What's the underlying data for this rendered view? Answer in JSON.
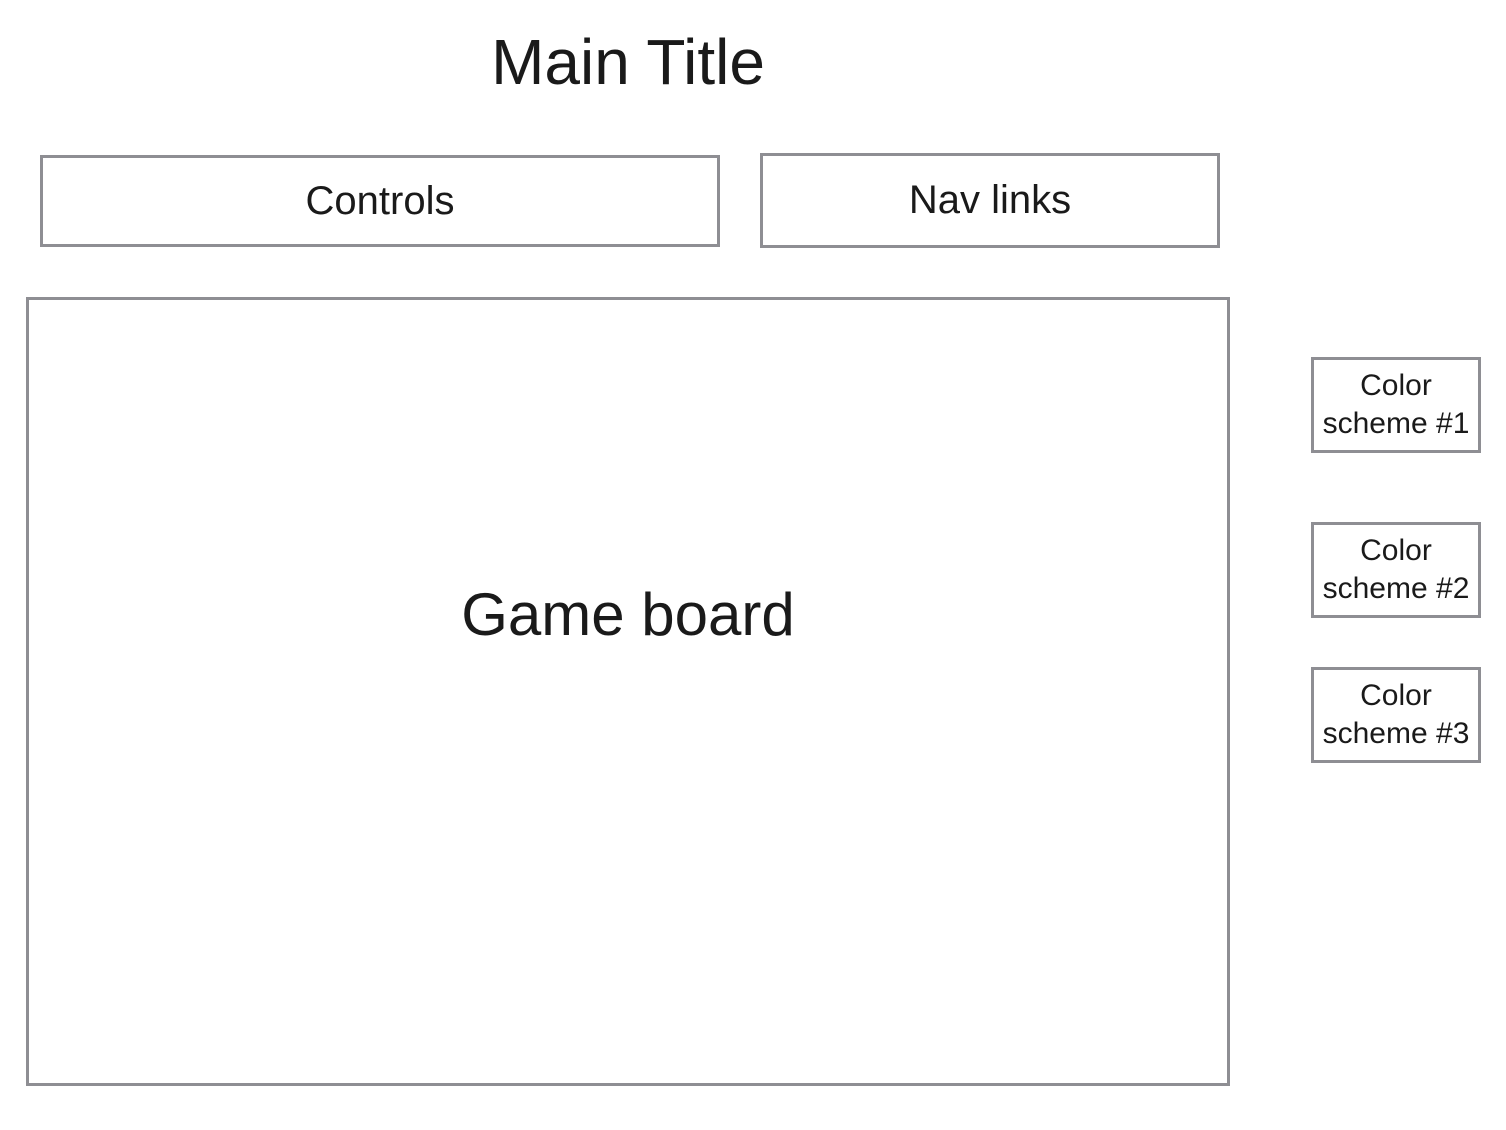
{
  "title": "Main Title",
  "controls": {
    "label": "Controls"
  },
  "nav": {
    "label": "Nav links"
  },
  "board": {
    "label": "Game board"
  },
  "color_schemes": [
    {
      "line1": "Color",
      "line2": "scheme #1"
    },
    {
      "line1": "Color",
      "line2": "scheme #2"
    },
    {
      "line1": "Color",
      "line2": "scheme #3"
    }
  ],
  "colors": {
    "border": "#8e8e93",
    "text": "#1a1a1a",
    "background": "#ffffff"
  }
}
